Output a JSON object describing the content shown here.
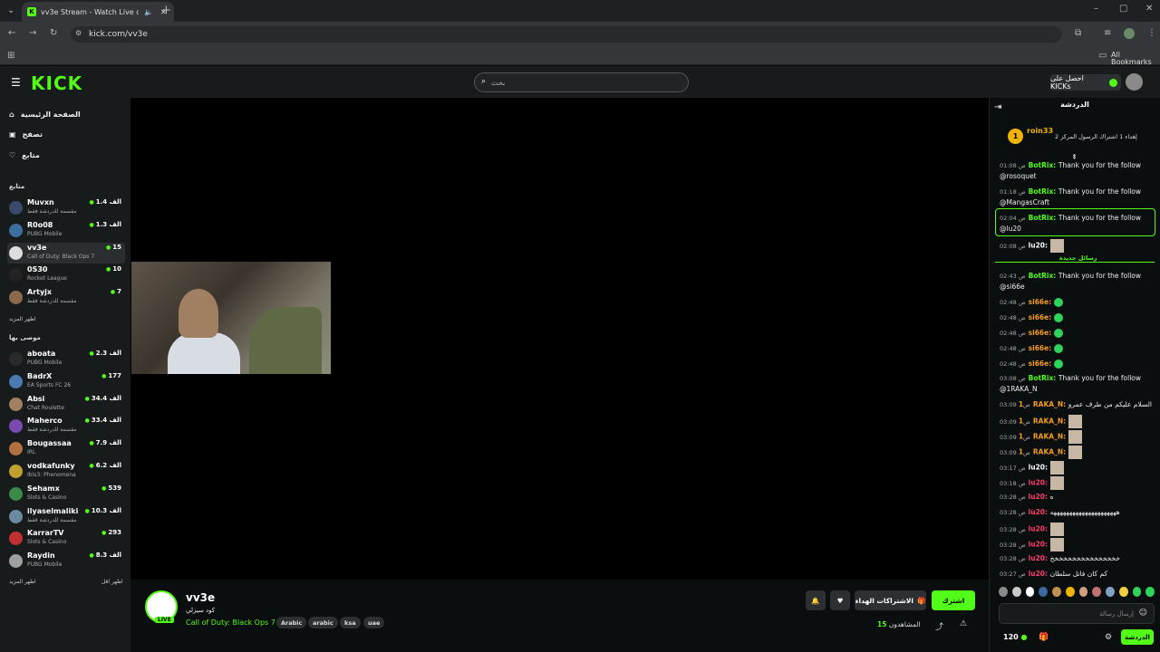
{
  "browser": {
    "tab_title": "vv3e Stream - Watch Live o",
    "url": "kick.com/vv3e",
    "all_bookmarks": "All Bookmarks"
  },
  "header": {
    "logo": "KICK",
    "search_placeholder": "بحث",
    "get_kicks": "احصل على KICKs"
  },
  "nav": {
    "home": "الصفحة الرئيسية",
    "browse": "تصفح",
    "following": "متابع"
  },
  "following_section": {
    "title": "متابع",
    "channels": [
      {
        "name": "Muvxn",
        "category": "مقسمة للدردشة فقط",
        "viewers": "1.4 الف",
        "color": "#3a4a6a"
      },
      {
        "name": "R0o08",
        "category": "PUBG Mobile",
        "viewers": "1.3 الف",
        "color": "#3c6ea0"
      },
      {
        "name": "vv3e",
        "category": "Call of Duty: Black Ops 7",
        "viewers": "15",
        "color": "#dddddd"
      },
      {
        "name": "0S30",
        "category": "Rocket League",
        "viewers": "10",
        "color": "#222222"
      },
      {
        "name": "Artyjx",
        "category": "مقسمة للدردشة فقط",
        "viewers": "7",
        "color": "#8a6a4a"
      }
    ],
    "show_more": "اظهر المزيد"
  },
  "recommended_section": {
    "title": "موصى بها",
    "channels": [
      {
        "name": "aboata",
        "category": "PUBG Mobile",
        "viewers": "2.3 الف",
        "color": "#2a2a2a"
      },
      {
        "name": "BadrX",
        "category": "EA Sports FC 26",
        "viewers": "177",
        "color": "#4a7ab0"
      },
      {
        "name": "Absi",
        "category": "Chat Roulette",
        "viewers": "34.4 الف",
        "color": "#a08060"
      },
      {
        "name": "Maherco",
        "category": "مقسمة للدردشة فقط",
        "viewers": "33.4 الف",
        "color": "#7a4ab0"
      },
      {
        "name": "Bougassaa",
        "category": "IRL",
        "viewers": "7.9 الف",
        "color": "#b07040"
      },
      {
        "name": "vodkafunky",
        "category": "Ibis3: Phenomena",
        "viewers": "6.2 الف",
        "color": "#c0a030"
      },
      {
        "name": "Sehamx",
        "category": "Slots & Casino",
        "viewers": "539",
        "color": "#3a8a4a"
      },
      {
        "name": "ilyaselmaliki",
        "category": "مقسمة للدردشة فقط",
        "viewers": "10.3 الف",
        "color": "#6a8aa0"
      },
      {
        "name": "KarrarTV",
        "category": "Slots & Casino",
        "viewers": "293",
        "color": "#c03030"
      },
      {
        "name": "Raydin",
        "category": "PUBG Mobile",
        "viewers": "8.3 الف",
        "color": "#a0a0a0"
      }
    ],
    "show_more": "اظهر المزيد",
    "show_less": "اظهر اقل"
  },
  "stream_info": {
    "channel_name": "vv3e",
    "live_badge": "LIVE",
    "title": "كود سيزلي",
    "category": "Call of Duty: Black Ops 7",
    "tags": [
      "Arabic",
      "arabic",
      "ksa",
      "uae"
    ],
    "follow_label": "اشترك",
    "gift_subs_label": "الاشتراكات الهداء",
    "viewers_label": "المشاهدون",
    "viewers_count": "15"
  },
  "chat": {
    "title": "الدردشة",
    "pinned_user": "roin33",
    "pinned_text": "إهداء 1 اشتراك الرسول المركز 2",
    "pinned_count": "1",
    "new_messages": "رسائل جديدة",
    "messages": [
      {
        "time": "01:08 ص",
        "user": "BotRix:",
        "text": "Thank you for the follow @rosoquet",
        "cls": "bot"
      },
      {
        "time": "01:18 ص",
        "user": "BotRix:",
        "text": "Thank you for the follow @MangasCraft",
        "cls": "bot"
      },
      {
        "time": "02:04 ص",
        "user": "BotRix:",
        "text": "Thank you for the follow @lu20",
        "cls": "bot"
      },
      {
        "time": "02:08 ص",
        "user": "lu20:",
        "text": "",
        "cls": "white"
      },
      {
        "time": "02:43 ص",
        "user": "BotRix:",
        "text": "Thank you for the follow @si66e",
        "cls": "bot"
      },
      {
        "time": "02:48 ص",
        "user": "si66e:",
        "text": "",
        "cls": "orange"
      },
      {
        "time": "02:48 ص",
        "user": "si66e:",
        "text": "",
        "cls": "orange"
      },
      {
        "time": "02:48 ص",
        "user": "si66e:",
        "text": "",
        "cls": "orange"
      },
      {
        "time": "02:48 ص",
        "user": "si66e:",
        "text": "",
        "cls": "orange"
      },
      {
        "time": "02:48 ص",
        "user": "si66e:",
        "text": "",
        "cls": "orange"
      },
      {
        "time": "03:08 ص",
        "user": "BotRix:",
        "text": "Thank you for the follow @1RAKA_N",
        "cls": "bot"
      },
      {
        "time": "03:09 ص",
        "user": "1RAKA_N:",
        "text": "السلام عليكم من طرف عمرو",
        "cls": "orange"
      },
      {
        "time": "03:09 ص",
        "user": "1RAKA_N:",
        "text": "",
        "cls": "orange"
      },
      {
        "time": "03:09 ص",
        "user": "1RAKA_N:",
        "text": "",
        "cls": "orange"
      },
      {
        "time": "03:09 ص",
        "user": "1RAKA_N:",
        "text": "",
        "cls": "orange"
      },
      {
        "time": "03:17 ص",
        "user": "lu20:",
        "text": "",
        "cls": "white"
      },
      {
        "time": "03:18 ص",
        "user": "lu20:",
        "text": "",
        "cls": "red"
      },
      {
        "time": "03:28 ص",
        "user": "lu20:",
        "text": "ه",
        "cls": "red"
      },
      {
        "time": "03:28 ص",
        "user": "lu20:",
        "text": "هههههههههههههههههههههه",
        "cls": "red"
      },
      {
        "time": "03:28 ص",
        "user": "lu20:",
        "text": "",
        "cls": "red"
      },
      {
        "time": "03:28 ص",
        "user": "lu20:",
        "text": "",
        "cls": "red"
      },
      {
        "time": "03:28 ص",
        "user": "lu20:",
        "text": "خخخخخخخخخخخخخخخخ",
        "cls": "red"
      },
      {
        "time": "03:27 ص",
        "user": "lu20:",
        "text": "كم كان فاتل سلطان",
        "cls": "red"
      }
    ],
    "input_placeholder": "إرسال رسالة",
    "send_label": "الدردشة",
    "kicks_count": "120"
  },
  "colors": {
    "accent": "#53fc18",
    "bg": "#0b0e0f",
    "panel": "#181b1c"
  }
}
